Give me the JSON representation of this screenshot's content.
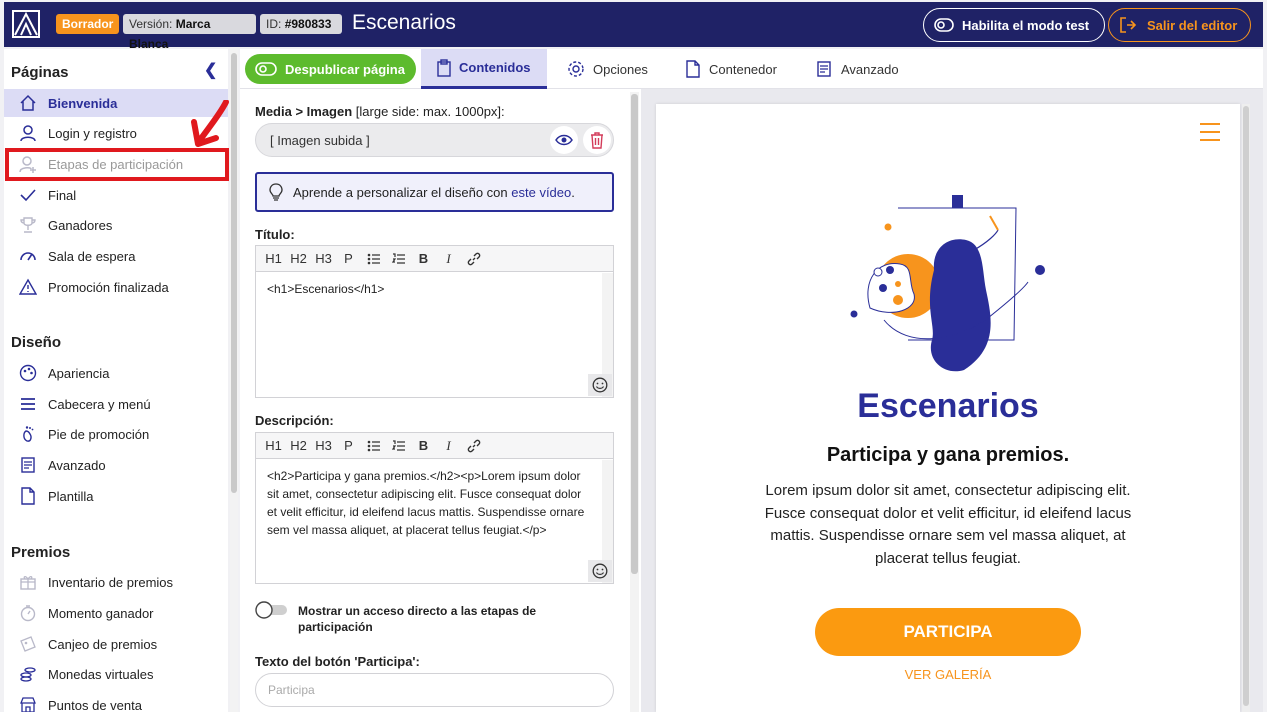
{
  "topbar": {
    "draft_badge": "Borrador",
    "version_label": "Versión:",
    "version_value": "Marca Blanca",
    "id_label": "ID:",
    "id_value": "#980833",
    "title": "Escenarios",
    "test_mode_button": "Habilita el modo test",
    "exit_button": "Salir del editor"
  },
  "sidebar": {
    "pages_title": "Páginas",
    "pages": [
      {
        "label": "Bienvenida",
        "icon": "home-icon"
      },
      {
        "label": "Login y registro",
        "icon": "user-icon"
      },
      {
        "label": "Etapas de participación",
        "icon": "user-plus-icon"
      },
      {
        "label": "Final",
        "icon": "check-icon"
      },
      {
        "label": "Ganadores",
        "icon": "trophy-icon"
      },
      {
        "label": "Sala de espera",
        "icon": "gauge-icon"
      },
      {
        "label": "Promoción finalizada",
        "icon": "warning-icon"
      }
    ],
    "design_title": "Diseño",
    "design": [
      {
        "label": "Apariencia",
        "icon": "palette-icon"
      },
      {
        "label": "Cabecera y menú",
        "icon": "menu-icon"
      },
      {
        "label": "Pie de promoción",
        "icon": "footprint-icon"
      },
      {
        "label": "Avanzado",
        "icon": "form-icon"
      },
      {
        "label": "Plantilla",
        "icon": "file-icon"
      }
    ],
    "prizes_title": "Premios",
    "prizes": [
      {
        "label": "Inventario de premios",
        "icon": "gift-icon"
      },
      {
        "label": "Momento ganador",
        "icon": "stopwatch-icon"
      },
      {
        "label": "Canjeo de premios",
        "icon": "ticket-icon"
      },
      {
        "label": "Monedas virtuales",
        "icon": "coins-icon"
      },
      {
        "label": "Puntos de venta",
        "icon": "store-icon"
      }
    ]
  },
  "tabs": {
    "unpublish_button": "Despublicar página",
    "items": [
      {
        "label": "Contenidos",
        "icon": "clipboard-icon"
      },
      {
        "label": "Opciones",
        "icon": "gear-icon"
      },
      {
        "label": "Contenedor",
        "icon": "document-icon"
      },
      {
        "label": "Avanzado",
        "icon": "form-icon"
      }
    ]
  },
  "editor": {
    "media_label": "Media > Imagen",
    "media_hint": "[large side: max. 1000px]:",
    "media_value": "[ Imagen subida ]",
    "tip_text": "Aprende a personalizar el diseño con",
    "tip_link": "este vídeo",
    "tip_end": ".",
    "toolbar": [
      "H1",
      "H2",
      "H3",
      "P"
    ],
    "title_label": "Título:",
    "title_value": "<h1>Escenarios</h1>",
    "description_label": "Descripción:",
    "description_value": "<h2>Participa y gana premios.</h2><p>Lorem ipsum dolor sit amet, consectetur adipiscing elit. Fusce consequat dolor et velit efficitur, id eleifend lacus mattis. Suspendisse ornare sem vel massa aliquet, at placerat tellus feugiat.</p>",
    "shortcut_toggle_label": "Mostrar un acceso directo a las etapas de participación",
    "button_text_label": "Texto del botón 'Participa':",
    "button_text_placeholder": "Participa"
  },
  "preview": {
    "title": "Escenarios",
    "subtitle": "Participa y gana premios.",
    "description": "Lorem ipsum dolor sit amet, consectetur adipiscing elit. Fusce consequat dolor et velit efficitur, id eleifend lacus mattis. Suspendisse ornare sem vel massa aliquet, at placerat tellus feugiat.",
    "cta": "PARTICIPA",
    "gallery_link": "VER GALERÍA"
  },
  "colors": {
    "navy": "#1f2266",
    "accent": "#2a2e98",
    "orange": "#f7941d",
    "green": "#5dbb2d",
    "highlight_red": "#e0191e"
  }
}
